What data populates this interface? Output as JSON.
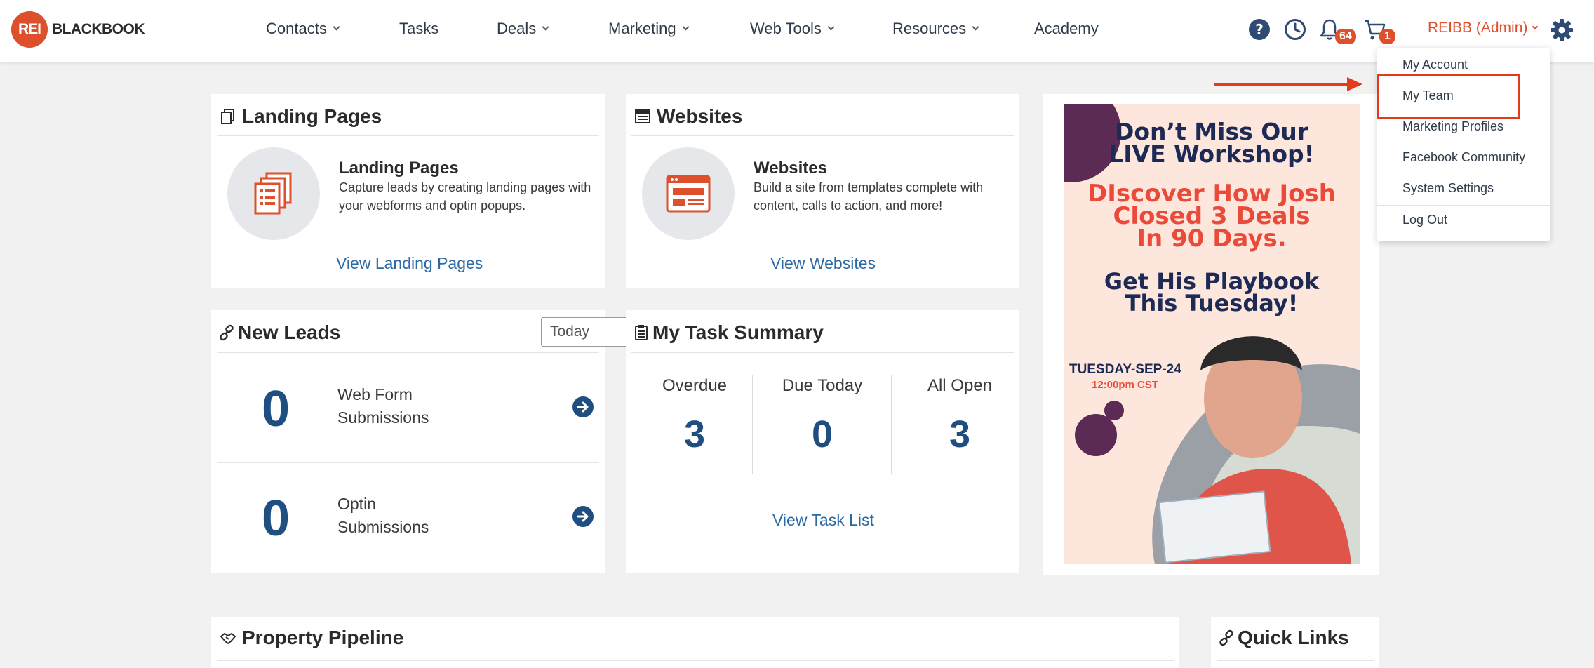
{
  "brand": {
    "badge": "REI",
    "name": "BLACKBOOK"
  },
  "nav": [
    {
      "label": "Contacts"
    },
    {
      "label": "Tasks"
    },
    {
      "label": "Deals"
    },
    {
      "label": "Marketing"
    },
    {
      "label": "Web Tools"
    },
    {
      "label": "Resources"
    },
    {
      "label": "Academy"
    }
  ],
  "header": {
    "notifications_count": "64",
    "cart_count": "1",
    "user_label": "REIBB (Admin)",
    "icons": [
      "help-icon",
      "clock-icon",
      "bell-icon",
      "cart-icon",
      "gear-icon"
    ]
  },
  "user_dropdown": {
    "items": [
      "My Account",
      "My Team",
      "Marketing Profiles",
      "Facebook Community",
      "System Settings",
      "Log Out"
    ]
  },
  "landing_pages": {
    "title": "Landing Pages",
    "feature_title": "Landing Pages",
    "description": "Capture leads by creating landing pages with your webforms and optin popups.",
    "link": "View Landing Pages"
  },
  "websites": {
    "title": "Websites",
    "feature_title": "Websites",
    "description": "Build a site from templates complete with content, calls to action, and more!",
    "link": "View Websites"
  },
  "new_leads": {
    "title": "New Leads",
    "period": "Today",
    "rows": [
      {
        "count": "0",
        "label_1": "Web Form",
        "label_2": "Submissions"
      },
      {
        "count": "0",
        "label_1": "Optin",
        "label_2": "Submissions"
      }
    ]
  },
  "task_summary": {
    "title": "My Task Summary",
    "columns": [
      {
        "label": "Overdue",
        "value": "3"
      },
      {
        "label": "Due Today",
        "value": "0"
      },
      {
        "label": "All Open",
        "value": "3"
      }
    ],
    "link": "View Task List"
  },
  "promo": {
    "line1": "Don’t Miss Our",
    "line2": "LIVE Workshop!",
    "line3": "DIscover How Josh",
    "line4": "Closed 3 Deals",
    "line5": "In  90 Days.",
    "line6": "Get His Playbook",
    "line7": "This Tuesday!",
    "date": "TUESDAY-SEP-24",
    "time": "12:00pm CST"
  },
  "property_pipeline": {
    "title": "Property Pipeline"
  },
  "quick_links": {
    "title": "Quick Links"
  },
  "colors": {
    "accent": "#de4f2b",
    "link": "#2d6aa3",
    "number": "#1f4e80",
    "annotation": "#e43b1b"
  }
}
